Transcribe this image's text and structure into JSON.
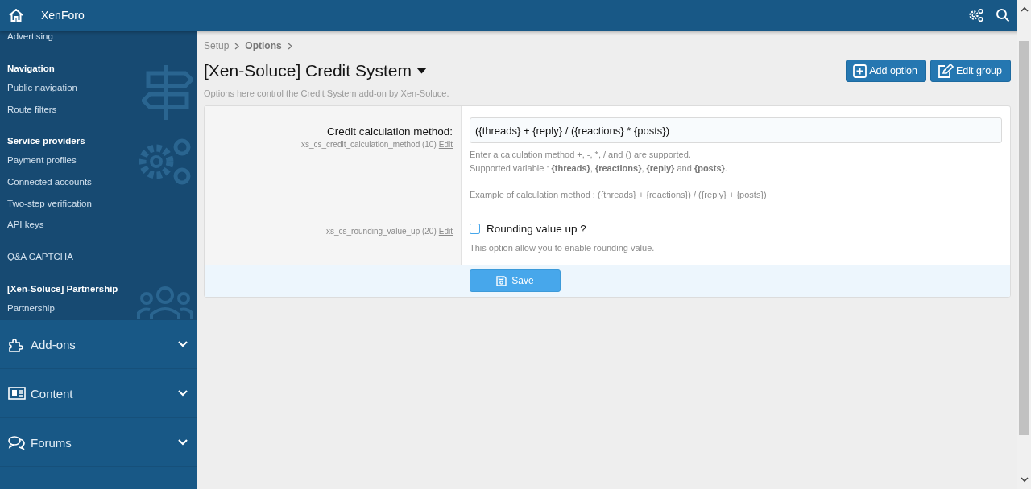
{
  "header": {
    "title": "XenForo"
  },
  "sidebar": {
    "groups": [
      {
        "items": [
          "Advertising"
        ]
      },
      {
        "heading": "Navigation",
        "items": [
          "Public navigation",
          "Route filters"
        ]
      },
      {
        "heading": "Service providers",
        "items": [
          "Payment profiles",
          "Connected accounts",
          "Two-step verification",
          "API keys"
        ]
      },
      {
        "items": [
          "Q&A CAPTCHA"
        ]
      },
      {
        "heading": "[Xen-Soluce] Partnership",
        "items": [
          "Partnership"
        ]
      }
    ],
    "sections": [
      {
        "label": "Add-ons",
        "expanded": false
      },
      {
        "label": "Content",
        "expanded": false
      },
      {
        "label": "Forums",
        "expanded": false
      }
    ]
  },
  "breadcrumbs": [
    {
      "label": "Setup",
      "current": false
    },
    {
      "label": "Options",
      "current": true
    }
  ],
  "page": {
    "title": "[Xen-Soluce] Credit System",
    "description": "Options here control the Credit System add-on by Xen-Soluce."
  },
  "actions": [
    {
      "label": "Add option"
    },
    {
      "label": "Edit group"
    }
  ],
  "options": [
    {
      "kind": "textbox",
      "label": "Credit calculation method:",
      "id_text": "xs_cs_credit_calculation_method (10)",
      "edit": "Edit",
      "value": "({threads} + {reply} / ({reactions} * {posts})",
      "explain": [
        "Enter a calculation method +, -, *, / and () are supported.",
        "Supported variable : **{threads}**, **{reactions}**, **{reply}** and **{posts}**."
      ],
      "example": "Example of calculation method : ({threads} + {reactions}) / ({reply} + {posts})"
    },
    {
      "kind": "checkbox",
      "id_text": "xs_cs_rounding_value_up (20)",
      "edit": "Edit",
      "label": "Rounding value up ?",
      "checked": false,
      "explain": [
        "This option allow you to enable rounding value."
      ]
    }
  ],
  "save": {
    "label": "Save"
  }
}
